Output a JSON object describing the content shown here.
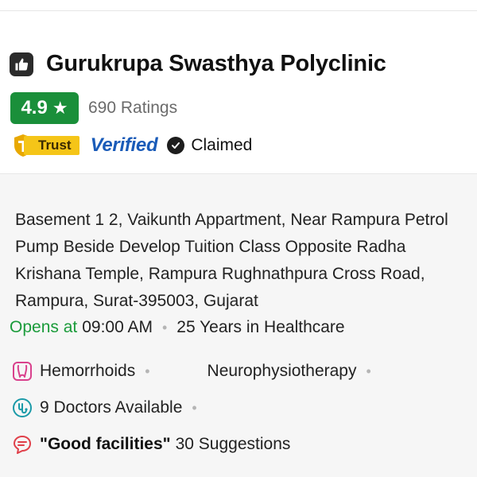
{
  "listing": {
    "name": "Gurukrupa Swasthya Polyclinic",
    "rating": "4.9",
    "rating_star": "★",
    "ratings_count": "690 Ratings",
    "trust_label": "Trust",
    "verified_label": "Verified",
    "claimed_label": "Claimed"
  },
  "details": {
    "address": "Basement 1 2, Vaikunth Appartment, Near Rampura Petrol Pump Beside Develop Tuition Class Opposite Radha Krishana Temple, Rampura Rughnathpura Cross Road, Rampura, Surat-395003, Gujarat",
    "opens_label": "Opens at",
    "opens_time": "09:00 AM",
    "experience": "25 Years in Healthcare",
    "service_1": "Hemorrhoids",
    "service_2": "Neurophysiotherapy",
    "doctors": "9 Doctors Available",
    "suggestion_quote": "\"Good facilities\"",
    "suggestion_count": "30 Suggestions",
    "separator": "•"
  },
  "colors": {
    "rating_green": "#1a8f3a",
    "opens_green": "#1a9b3a",
    "verified_blue": "#1a5bb8",
    "trust_yellow": "#f5c518",
    "body_bg": "#f6f6f6"
  },
  "icons": {
    "title": "thumbs-up-icon",
    "trust": "trust-shield-icon",
    "claimed": "check-circle-icon",
    "service": "body-icon",
    "doctors": "stethoscope-icon",
    "suggestions": "chat-bubble-icon"
  }
}
